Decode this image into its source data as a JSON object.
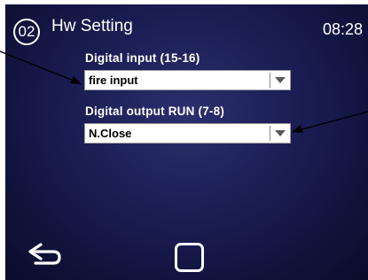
{
  "header": {
    "screen_number": "02",
    "title": "Hw Setting",
    "time": "08:28"
  },
  "fields": [
    {
      "label": "Digital input (15-16)",
      "value": "fire input"
    },
    {
      "label": "Digital output RUN (7-8)",
      "value": "N.Close"
    }
  ],
  "footer": {
    "back_icon": "back-arrow-icon",
    "home_icon": "square-home-icon"
  },
  "colors": {
    "screen_background": "#1a1d52",
    "text": "#ffffff",
    "dropdown_background": "#ffffff"
  }
}
